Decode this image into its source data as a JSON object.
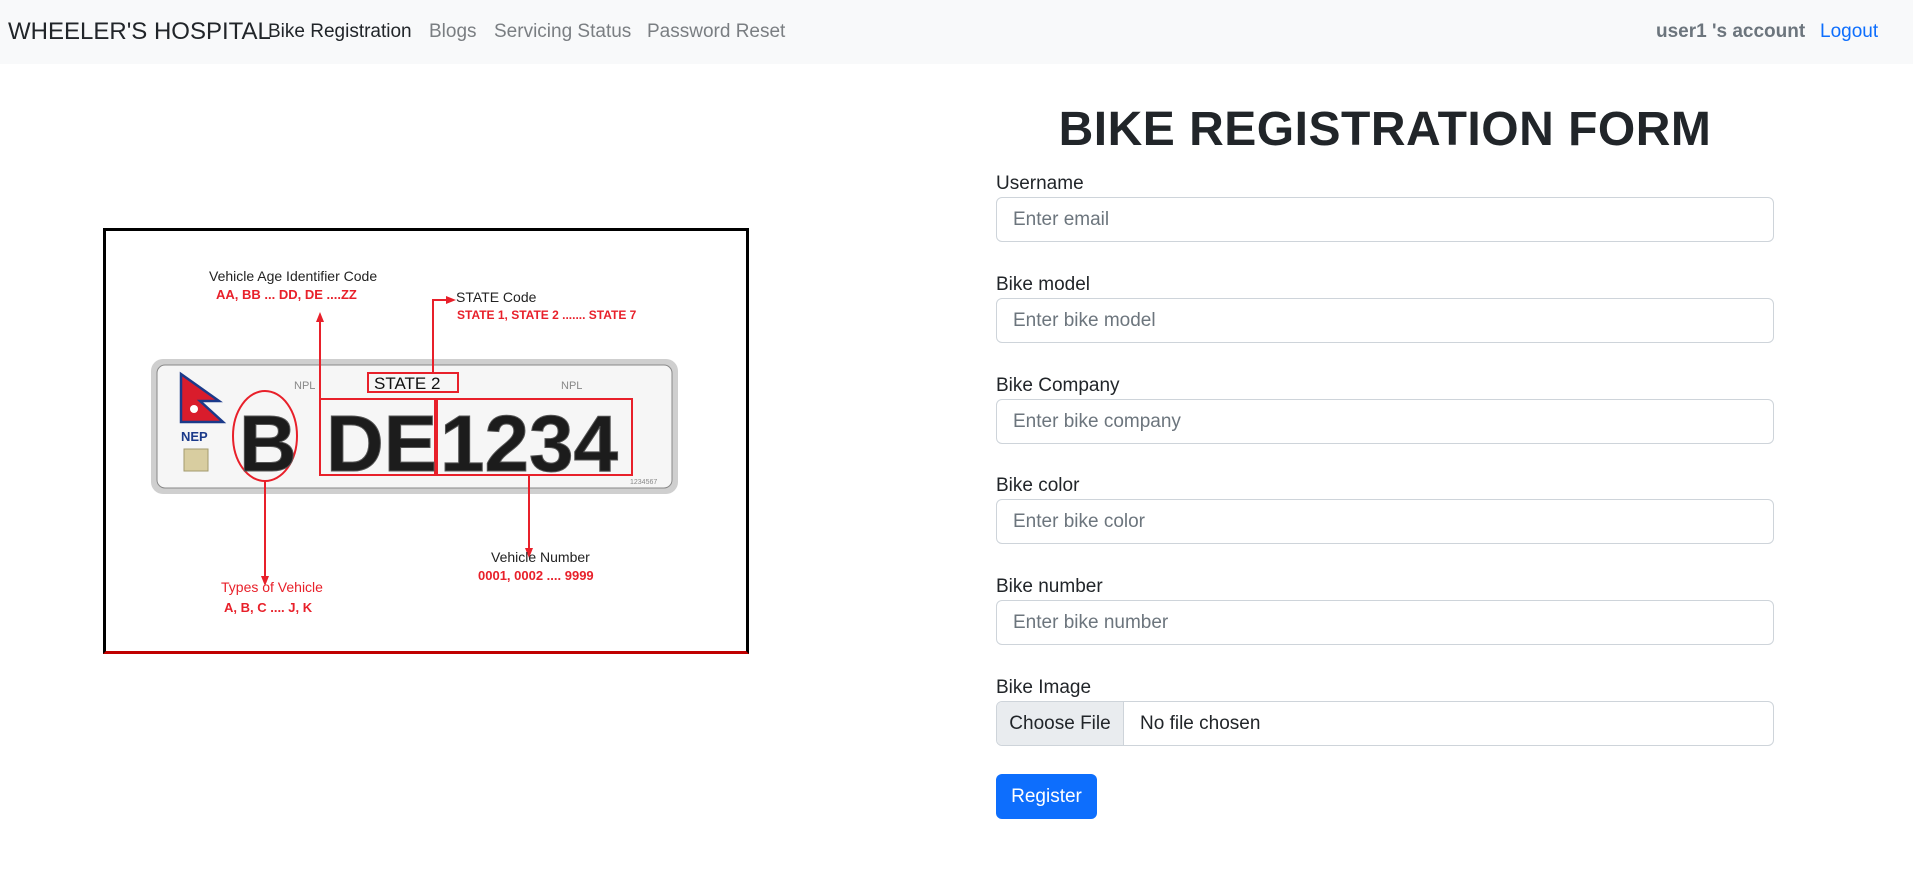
{
  "navbar": {
    "brand": "WHEELER'S HOSPITAL",
    "links": [
      {
        "label": "Bike Registration",
        "active": true
      },
      {
        "label": "Blogs",
        "active": false
      },
      {
        "label": "Servicing Status",
        "active": false
      },
      {
        "label": "Password Reset",
        "active": false
      }
    ],
    "account": "user1 's account",
    "logout": "Logout"
  },
  "illustration": {
    "age_code_title": "Vehicle Age Identifier Code",
    "age_code_values": "AA, BB ... DD, DE ....ZZ",
    "state_code_title": "STATE Code",
    "state_code_values": "STATE 1, STATE 2 ....... STATE 7",
    "plate_state": "STATE 2",
    "plate_country": "NEP",
    "plate_npl_left": "NPL",
    "plate_npl_right": "NPL",
    "plate_type": "B",
    "plate_age": "DE",
    "plate_number": "1234",
    "plate_serial": "1234567",
    "vehicle_number_title": "Vehicle Number",
    "vehicle_number_values": "0001, 0002 .... 9999",
    "types_title": "Types of Vehicle",
    "types_values": "A, B, C .... J, K"
  },
  "form": {
    "title": "BIKE REGISTRATION FORM",
    "fields": [
      {
        "label": "Username",
        "placeholder": "Enter email",
        "value": ""
      },
      {
        "label": "Bike model",
        "placeholder": "Enter bike model",
        "value": ""
      },
      {
        "label": "Bike Company",
        "placeholder": "Enter bike company",
        "value": ""
      },
      {
        "label": "Bike color",
        "placeholder": "Enter bike color",
        "value": ""
      },
      {
        "label": "Bike number",
        "placeholder": "Enter bike number",
        "value": ""
      }
    ],
    "image": {
      "label": "Bike Image",
      "button": "Choose File",
      "status": "No file chosen"
    },
    "submit": "Register"
  },
  "colors": {
    "primary": "#0d6efd",
    "navbar_bg": "#f8f9fa",
    "annotation_red": "#e8202a"
  }
}
